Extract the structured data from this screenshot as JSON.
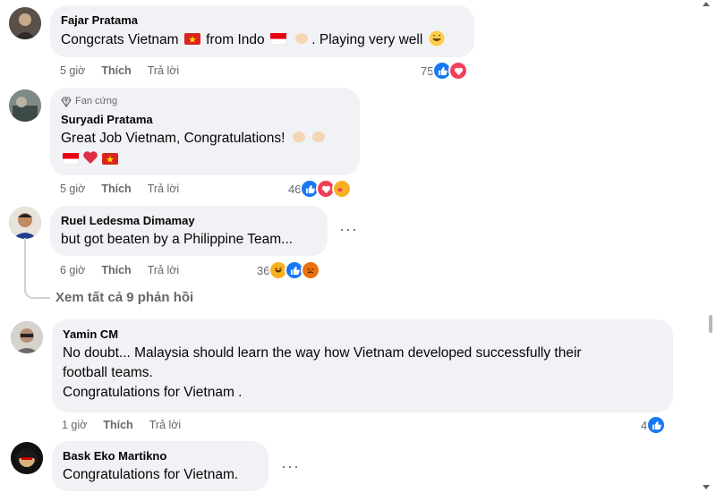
{
  "comments": [
    {
      "name": "Fajar Pratama",
      "text_a": "Congcrats Vietnam",
      "text_b": "from Indo",
      "text_c": ". Playing very well",
      "time": "5 giờ",
      "like": "Thích",
      "reply": "Trả lời",
      "reaction_count": "75",
      "reactions": [
        "like-icon",
        "love-icon"
      ]
    },
    {
      "badge": "Fan cứng",
      "name": "Suryadi Pratama",
      "text": "Great Job Vietnam, Congratulations!",
      "time": "5 giờ",
      "like": "Thích",
      "reply": "Trả lời",
      "reaction_count": "46",
      "reactions": [
        "like-icon",
        "love-icon",
        "care-icon"
      ]
    },
    {
      "name": "Ruel Ledesma Dimamay",
      "text": "but got beaten by a Philippine Team...",
      "time": "6 giờ",
      "like": "Thích",
      "reply": "Trả lời",
      "reaction_count": "36",
      "reactions": [
        "haha-icon",
        "like-icon",
        "angry-icon"
      ]
    },
    {
      "name": "Yamin CM",
      "text_line1": "No doubt... Malaysia should learn the way how Vietnam developed successfully their",
      "text_line2": "football teams.",
      "text_line3": "Congratulations for Vietnam .",
      "time": "1 giờ",
      "like": "Thích",
      "reply": "Trả lời",
      "reaction_count": "4",
      "reactions": [
        "like-icon"
      ]
    },
    {
      "name": "Bask Eko Martikno",
      "text": "Congratulations for Vietnam."
    }
  ],
  "view_all_replies": "Xem tất cả 9 phản hồi",
  "more_options": "···"
}
